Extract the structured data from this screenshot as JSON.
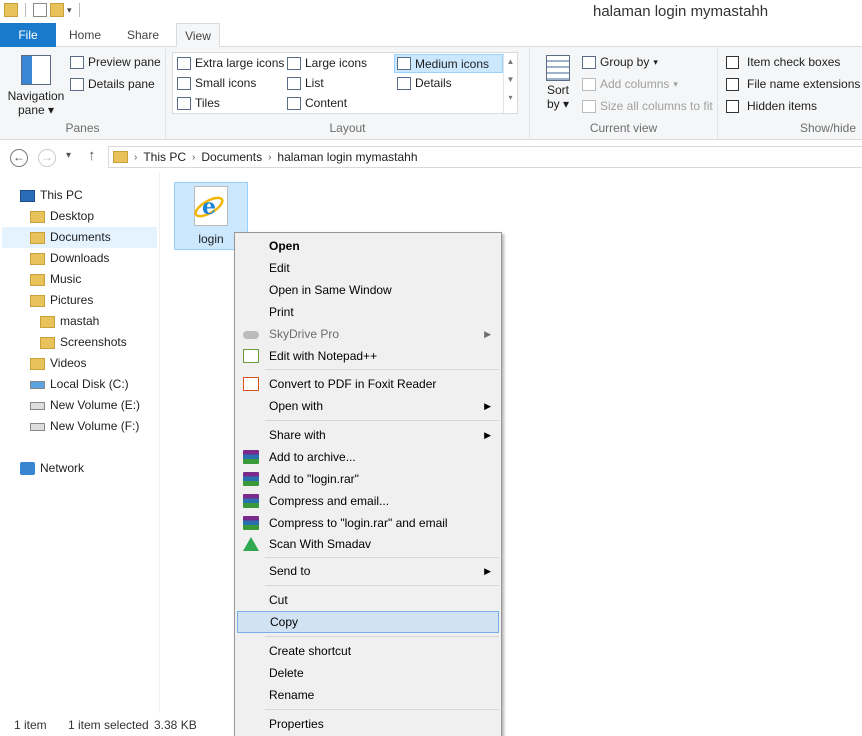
{
  "window": {
    "title": "halaman login mymastahh"
  },
  "tabs": {
    "file": "File",
    "home": "Home",
    "share": "Share",
    "view": "View"
  },
  "ribbon": {
    "panes": {
      "nav_pane_line1": "Navigation",
      "nav_pane_line2": "pane",
      "preview_pane": "Preview pane",
      "details_pane": "Details pane",
      "label": "Panes"
    },
    "layout": {
      "extra_large_icons": "Extra large icons",
      "large_icons": "Large icons",
      "medium_icons": "Medium icons",
      "small_icons": "Small icons",
      "list": "List",
      "details": "Details",
      "tiles": "Tiles",
      "content": "Content",
      "label": "Layout",
      "selected": "Medium icons"
    },
    "current_view": {
      "sort_line1": "Sort",
      "sort_line2": "by",
      "group_by": "Group by",
      "add_columns": "Add columns",
      "size_all_columns": "Size all columns to fit",
      "label": "Current view"
    },
    "show_hide": {
      "item_check_boxes": "Item check boxes",
      "file_name_extensions": "File name extensions",
      "hidden_items": "Hidden items",
      "label": "Show/hide"
    }
  },
  "address": {
    "crumbs": [
      "This PC",
      "Documents",
      "halaman login mymastahh"
    ]
  },
  "nav": {
    "this_pc": "This PC",
    "desktop": "Desktop",
    "documents": "Documents",
    "downloads": "Downloads",
    "music": "Music",
    "pictures": "Pictures",
    "mastah": "mastah",
    "screenshots": "Screenshots",
    "videos": "Videos",
    "local_disk": "Local Disk (C:)",
    "new_volume_e": "New Volume (E:)",
    "new_volume_f": "New Volume (F:)",
    "network": "Network"
  },
  "files": [
    {
      "name": "login"
    }
  ],
  "status": {
    "count": "1 item",
    "selected": "1 item selected",
    "size": "3.38 KB"
  },
  "context_menu": {
    "open": "Open",
    "edit": "Edit",
    "open_same_window": "Open in Same Window",
    "print": "Print",
    "skydrive_pro": "SkyDrive Pro",
    "edit_notepad": "Edit with Notepad++",
    "convert_pdf": "Convert to PDF in Foxit Reader",
    "open_with": "Open with",
    "share_with": "Share with",
    "add_archive": "Add to archive...",
    "add_login_rar": "Add to \"login.rar\"",
    "compress_email": "Compress and email...",
    "compress_login_email": "Compress to \"login.rar\" and email",
    "scan_smadav": "Scan With Smadav",
    "send_to": "Send to",
    "cut": "Cut",
    "copy": "Copy",
    "create_shortcut": "Create shortcut",
    "delete": "Delete",
    "rename": "Rename",
    "properties": "Properties"
  },
  "colors": {
    "file_tab": "#1979ca",
    "selection": "#cce8ff",
    "menu_highlight": "#d1e2f2"
  }
}
